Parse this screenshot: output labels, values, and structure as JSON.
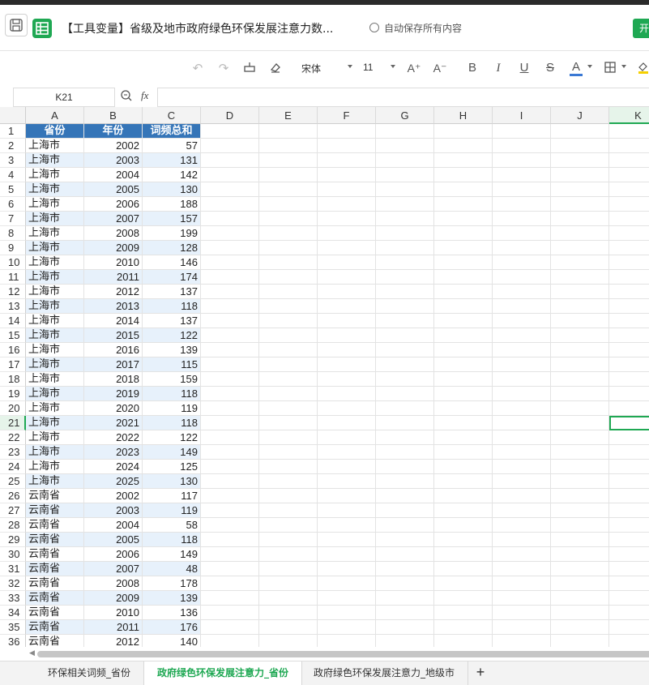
{
  "window": {
    "doc_title": "【工具变量】省级及地市政府绿色环保发展注意力数...",
    "autosave": "自动保存所有内容",
    "open_button": "开"
  },
  "toolbar": {
    "font_name": "宋体",
    "font_size": "11",
    "grow_font": "A⁺",
    "shrink_font": "A⁻",
    "bold": "B",
    "italic": "I",
    "underline": "U",
    "strike": "S",
    "font_color_letter": "A"
  },
  "formula": {
    "cell_ref": "K21",
    "fx_label": "fx",
    "content": ""
  },
  "columns": [
    "A",
    "B",
    "C",
    "D",
    "E",
    "F",
    "G",
    "H",
    "I",
    "J",
    "K"
  ],
  "selected_column": "K",
  "selected_row": 21,
  "table": {
    "headers": [
      "省份",
      "年份",
      "词频总和"
    ],
    "rows": [
      [
        "上海市",
        "2002",
        "57"
      ],
      [
        "上海市",
        "2003",
        "131"
      ],
      [
        "上海市",
        "2004",
        "142"
      ],
      [
        "上海市",
        "2005",
        "130"
      ],
      [
        "上海市",
        "2006",
        "188"
      ],
      [
        "上海市",
        "2007",
        "157"
      ],
      [
        "上海市",
        "2008",
        "199"
      ],
      [
        "上海市",
        "2009",
        "128"
      ],
      [
        "上海市",
        "2010",
        "146"
      ],
      [
        "上海市",
        "2011",
        "174"
      ],
      [
        "上海市",
        "2012",
        "137"
      ],
      [
        "上海市",
        "2013",
        "118"
      ],
      [
        "上海市",
        "2014",
        "137"
      ],
      [
        "上海市",
        "2015",
        "122"
      ],
      [
        "上海市",
        "2016",
        "139"
      ],
      [
        "上海市",
        "2017",
        "115"
      ],
      [
        "上海市",
        "2018",
        "159"
      ],
      [
        "上海市",
        "2019",
        "118"
      ],
      [
        "上海市",
        "2020",
        "119"
      ],
      [
        "上海市",
        "2021",
        "118"
      ],
      [
        "上海市",
        "2022",
        "122"
      ],
      [
        "上海市",
        "2023",
        "149"
      ],
      [
        "上海市",
        "2024",
        "125"
      ],
      [
        "上海市",
        "2025",
        "130"
      ],
      [
        "云南省",
        "2002",
        "117"
      ],
      [
        "云南省",
        "2003",
        "119"
      ],
      [
        "云南省",
        "2004",
        "58"
      ],
      [
        "云南省",
        "2005",
        "118"
      ],
      [
        "云南省",
        "2006",
        "149"
      ],
      [
        "云南省",
        "2007",
        "48"
      ],
      [
        "云南省",
        "2008",
        "178"
      ],
      [
        "云南省",
        "2009",
        "139"
      ],
      [
        "云南省",
        "2010",
        "136"
      ],
      [
        "云南省",
        "2011",
        "176"
      ],
      [
        "云南省",
        "2012",
        "140"
      ]
    ]
  },
  "sheet_tabs": [
    "环保相关词频_省份",
    "政府绿色环保发展注意力_省份",
    "政府绿色环保发展注意力_地级市"
  ],
  "active_sheet": "政府绿色环保发展注意力_省份",
  "add_sheet": "+",
  "colors": {
    "accent": "#1fa853",
    "header_fill": "#3575b8",
    "band_fill": "#e7f1fb"
  }
}
